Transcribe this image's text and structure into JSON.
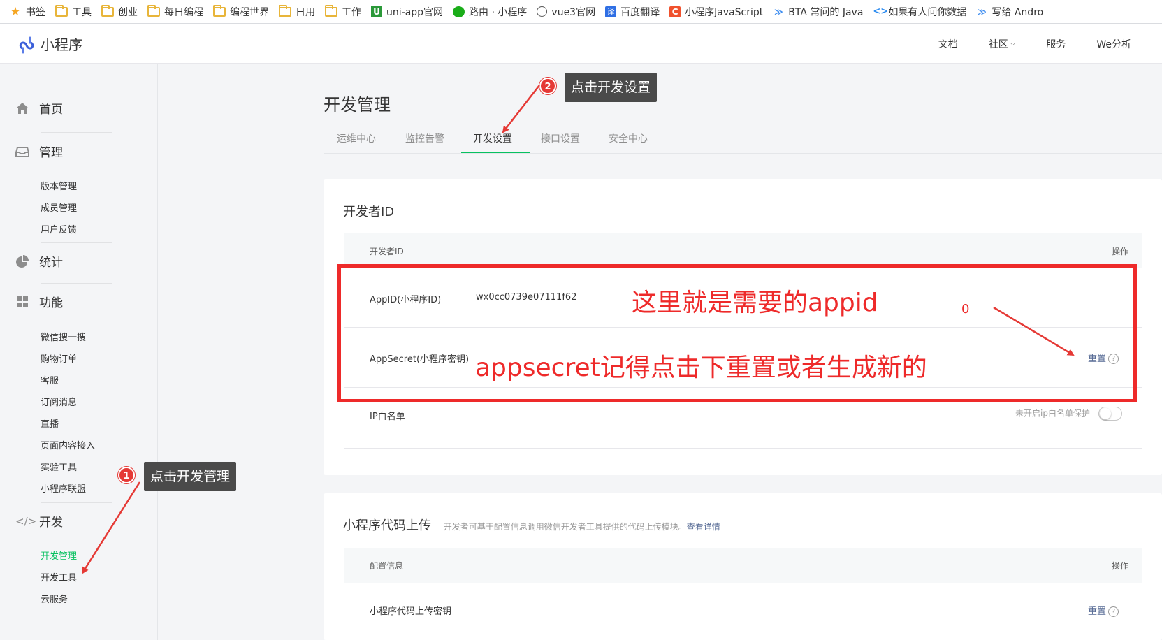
{
  "bookmarks_bar": {
    "items": [
      {
        "label": "书签",
        "icon": "star-icon"
      },
      {
        "label": "工具",
        "icon": "folder-icon"
      },
      {
        "label": "创业",
        "icon": "folder-icon"
      },
      {
        "label": "每日编程",
        "icon": "folder-icon"
      },
      {
        "label": "编程世界",
        "icon": "folder-icon"
      },
      {
        "label": "日用",
        "icon": "folder-icon"
      },
      {
        "label": "工作",
        "icon": "folder-icon"
      },
      {
        "label": "uni-app官网",
        "icon": "uniapp-icon"
      },
      {
        "label": "路由 · 小程序",
        "icon": "wechat-icon"
      },
      {
        "label": "vue3官网",
        "icon": "globe-icon"
      },
      {
        "label": "百度翻译",
        "icon": "translate-icon"
      },
      {
        "label": "小程序JavaScript",
        "icon": "csdn-icon"
      },
      {
        "label": "BTA 常问的 Java",
        "icon": "chevron-icon"
      },
      {
        "label": "如果有人问你数据",
        "icon": "code-icon"
      },
      {
        "label": "写给 Andro",
        "icon": "chevron-icon"
      }
    ]
  },
  "header": {
    "logo_text": "小程序",
    "nav": [
      {
        "label": "文档"
      },
      {
        "label": "社区"
      },
      {
        "label": "服务"
      },
      {
        "label": "We分析"
      }
    ]
  },
  "sidebar": {
    "sections": [
      {
        "label": "首页",
        "icon": "home-icon"
      },
      {
        "label": "管理",
        "icon": "inbox-icon",
        "items": [
          "版本管理",
          "成员管理",
          "用户反馈"
        ]
      },
      {
        "label": "统计",
        "icon": "pie-chart-icon"
      },
      {
        "label": "功能",
        "icon": "grid-icon",
        "items": [
          "微信搜一搜",
          "购物订单",
          "客服",
          "订阅消息",
          "直播",
          "页面内容接入",
          "实验工具",
          "小程序联盟"
        ]
      },
      {
        "label": "开发",
        "icon": "code-icon",
        "items": [
          "开发管理",
          "开发工具",
          "云服务"
        ]
      }
    ],
    "active_item": "开发管理"
  },
  "main": {
    "title": "开发管理",
    "tabs": [
      "运维中心",
      "监控告警",
      "开发设置",
      "接口设置",
      "安全中心"
    ],
    "active_tab": "开发设置",
    "developer_id": {
      "title": "开发者ID",
      "col_id": "开发者ID",
      "col_action": "操作",
      "appid_label": "AppID(小程序ID)",
      "appid_value": "wx0cc0739e07111f62",
      "appsecret_label": "AppSecret(小程序密钥)",
      "reset_label": "重置",
      "ip_label": "IP白名单",
      "ip_status": "未开启ip白名单保护"
    },
    "upload": {
      "title": "小程序代码上传",
      "desc": "开发者可基于配置信息调用微信开发者工具提供的代码上传模块。",
      "details_link": "查看详情",
      "col_config": "配置信息",
      "col_action": "操作",
      "key_label": "小程序代码上传密钥",
      "reset_label": "重置"
    }
  },
  "annotations": {
    "callout1": "点击开发管理",
    "badge1": "1",
    "callout2": "点击开发设置",
    "badge2": "2",
    "note_appid": "这里就是需要的appid",
    "note_zero": "0",
    "note_appsecret": "appsecret记得点击下重置或者生成新的"
  },
  "colors": {
    "accent": "#07c160",
    "link": "#576b95",
    "annotation_red": "#ee2a2a"
  }
}
